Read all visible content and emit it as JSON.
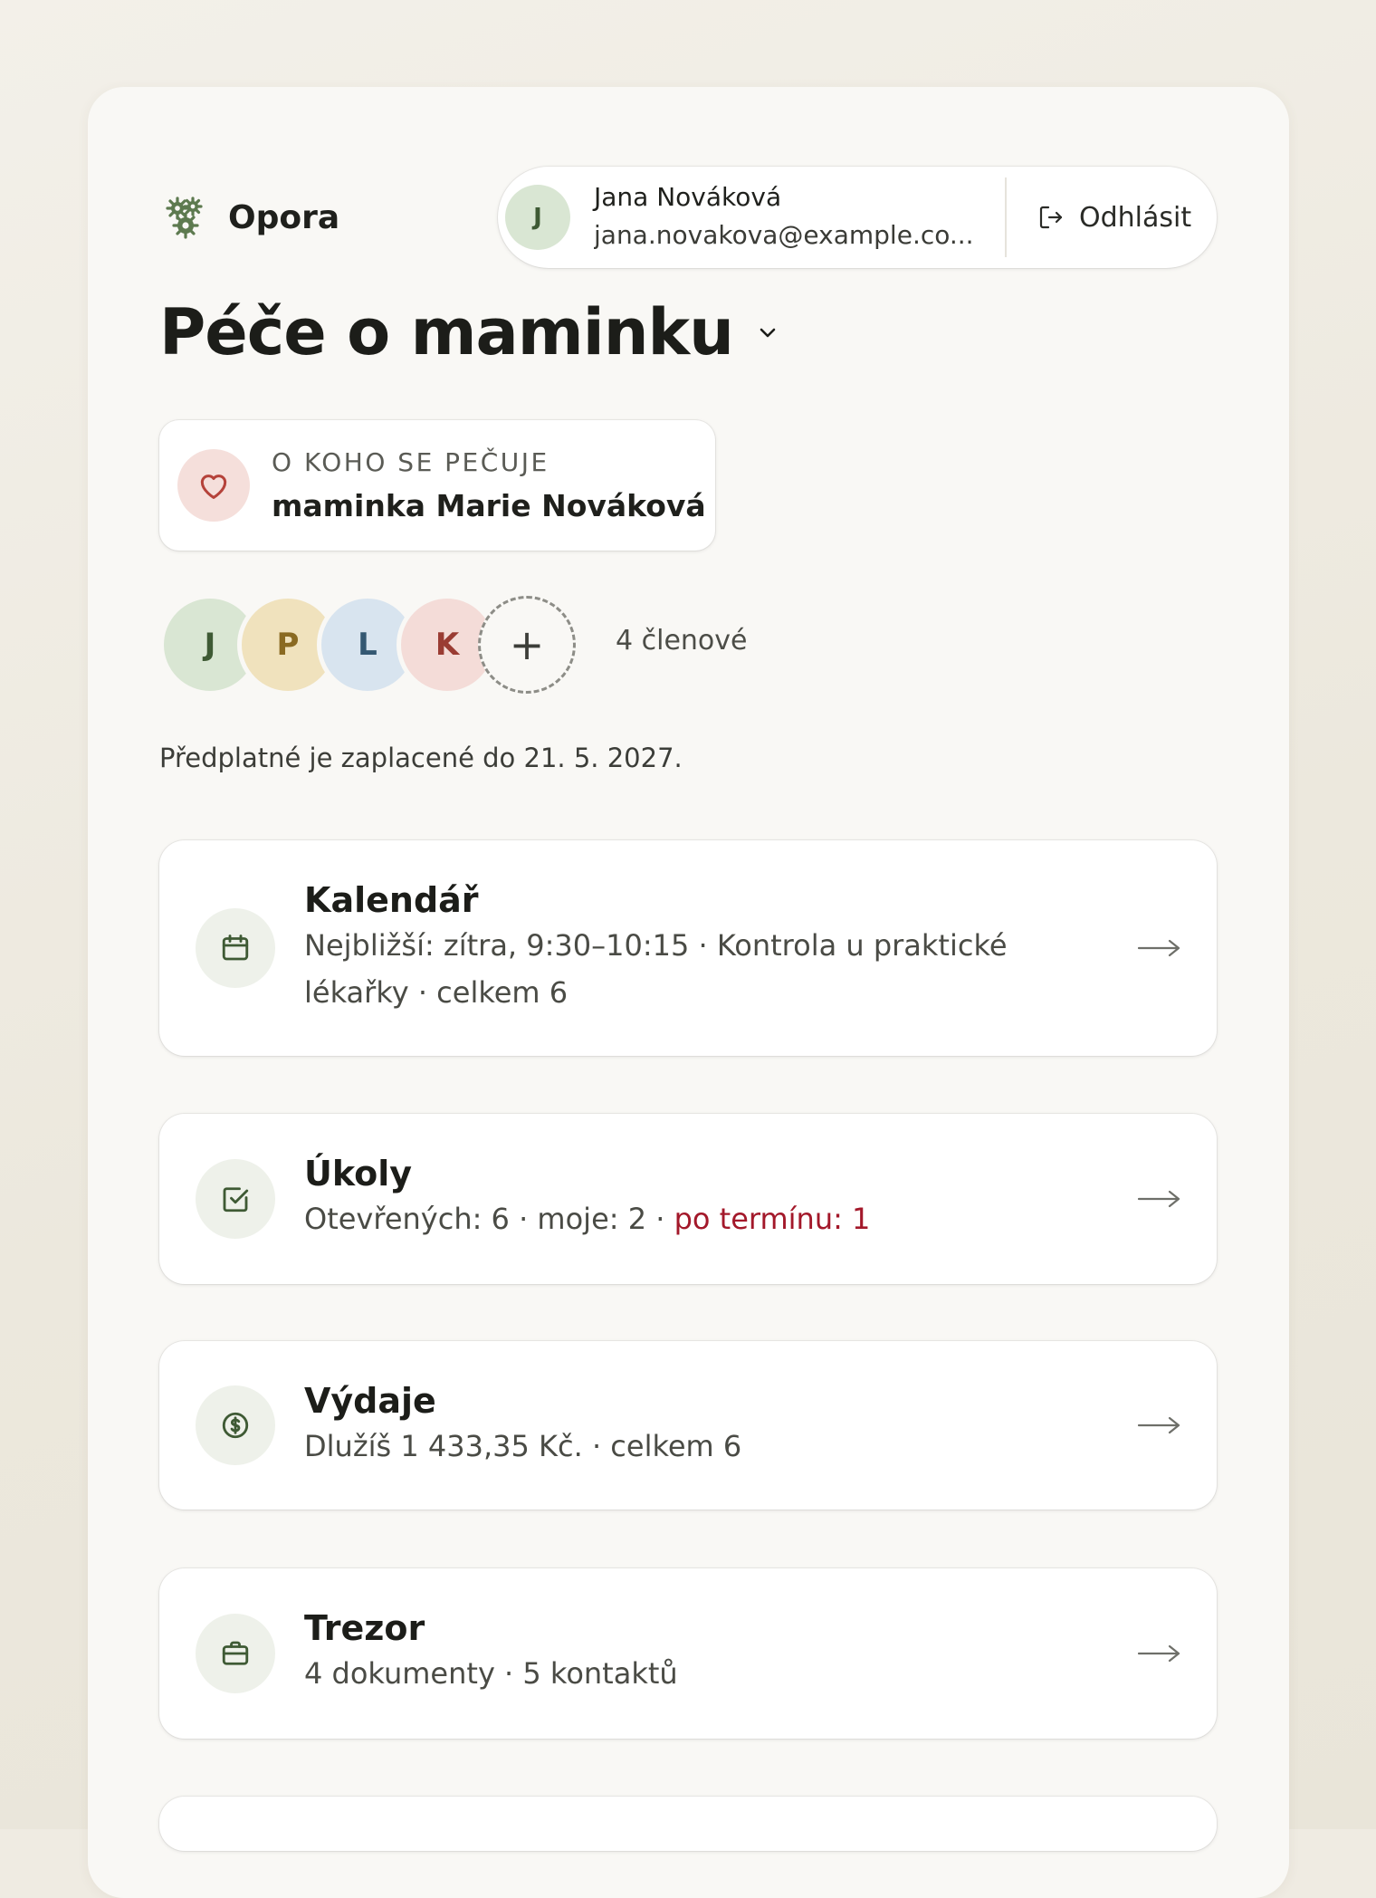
{
  "brand": {
    "name": "Opora"
  },
  "account": {
    "avatar_initial": "J",
    "name": "Jana Nováková",
    "email": "jana.novakova@example.co...",
    "logout_label": "Odhlásit"
  },
  "page": {
    "title": "Péče o maminku"
  },
  "care_recipient": {
    "label": "O KOHO SE PEČUJE",
    "name": "maminka Marie Nováková"
  },
  "members": {
    "initials": [
      "J",
      "P",
      "L",
      "K"
    ],
    "add_symbol": "+",
    "count_label": "4 členové"
  },
  "subscription": {
    "text": "Předplatné je zaplacené do 21. 5. 2027."
  },
  "modules": {
    "calendar": {
      "title": "Kalendář",
      "subtitle": "Nejbližší: zítra, 9:30–10:15 · Kontrola u praktické lékařky · celkem 6",
      "icon": "calendar-icon"
    },
    "tasks": {
      "title": "Úkoly",
      "subtitle_main": "Otevřených: 6 · moje: 2",
      "subtitle_sep": " · ",
      "subtitle_overdue": "po termínu: 1",
      "icon": "checkbox-icon",
      "overdue_color": "#a3182a"
    },
    "expenses": {
      "title": "Výdaje",
      "subtitle": "Dlužíš 1 433,35 Kč. · celkem 6",
      "icon": "coin-icon"
    },
    "vault": {
      "title": "Trezor",
      "subtitle": "4 dokumenty · 5 kontaktů",
      "icon": "briefcase-icon"
    }
  },
  "colors": {
    "accent_green": "#3e5a34",
    "panel_bg": "#f9f8f5",
    "page_bg": "#efebe2"
  }
}
